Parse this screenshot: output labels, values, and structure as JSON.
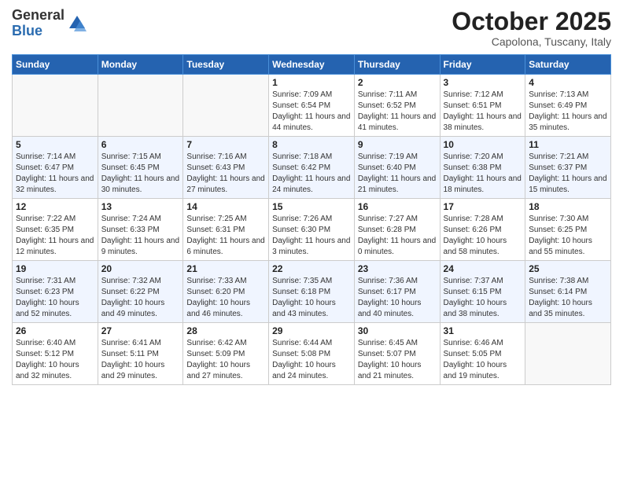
{
  "logo": {
    "general": "General",
    "blue": "Blue"
  },
  "header": {
    "month": "October 2025",
    "location": "Capolona, Tuscany, Italy"
  },
  "days_of_week": [
    "Sunday",
    "Monday",
    "Tuesday",
    "Wednesday",
    "Thursday",
    "Friday",
    "Saturday"
  ],
  "weeks": [
    [
      {
        "day": "",
        "info": ""
      },
      {
        "day": "",
        "info": ""
      },
      {
        "day": "",
        "info": ""
      },
      {
        "day": "1",
        "info": "Sunrise: 7:09 AM\nSunset: 6:54 PM\nDaylight: 11 hours and 44 minutes."
      },
      {
        "day": "2",
        "info": "Sunrise: 7:11 AM\nSunset: 6:52 PM\nDaylight: 11 hours and 41 minutes."
      },
      {
        "day": "3",
        "info": "Sunrise: 7:12 AM\nSunset: 6:51 PM\nDaylight: 11 hours and 38 minutes."
      },
      {
        "day": "4",
        "info": "Sunrise: 7:13 AM\nSunset: 6:49 PM\nDaylight: 11 hours and 35 minutes."
      }
    ],
    [
      {
        "day": "5",
        "info": "Sunrise: 7:14 AM\nSunset: 6:47 PM\nDaylight: 11 hours and 32 minutes."
      },
      {
        "day": "6",
        "info": "Sunrise: 7:15 AM\nSunset: 6:45 PM\nDaylight: 11 hours and 30 minutes."
      },
      {
        "day": "7",
        "info": "Sunrise: 7:16 AM\nSunset: 6:43 PM\nDaylight: 11 hours and 27 minutes."
      },
      {
        "day": "8",
        "info": "Sunrise: 7:18 AM\nSunset: 6:42 PM\nDaylight: 11 hours and 24 minutes."
      },
      {
        "day": "9",
        "info": "Sunrise: 7:19 AM\nSunset: 6:40 PM\nDaylight: 11 hours and 21 minutes."
      },
      {
        "day": "10",
        "info": "Sunrise: 7:20 AM\nSunset: 6:38 PM\nDaylight: 11 hours and 18 minutes."
      },
      {
        "day": "11",
        "info": "Sunrise: 7:21 AM\nSunset: 6:37 PM\nDaylight: 11 hours and 15 minutes."
      }
    ],
    [
      {
        "day": "12",
        "info": "Sunrise: 7:22 AM\nSunset: 6:35 PM\nDaylight: 11 hours and 12 minutes."
      },
      {
        "day": "13",
        "info": "Sunrise: 7:24 AM\nSunset: 6:33 PM\nDaylight: 11 hours and 9 minutes."
      },
      {
        "day": "14",
        "info": "Sunrise: 7:25 AM\nSunset: 6:31 PM\nDaylight: 11 hours and 6 minutes."
      },
      {
        "day": "15",
        "info": "Sunrise: 7:26 AM\nSunset: 6:30 PM\nDaylight: 11 hours and 3 minutes."
      },
      {
        "day": "16",
        "info": "Sunrise: 7:27 AM\nSunset: 6:28 PM\nDaylight: 11 hours and 0 minutes."
      },
      {
        "day": "17",
        "info": "Sunrise: 7:28 AM\nSunset: 6:26 PM\nDaylight: 10 hours and 58 minutes."
      },
      {
        "day": "18",
        "info": "Sunrise: 7:30 AM\nSunset: 6:25 PM\nDaylight: 10 hours and 55 minutes."
      }
    ],
    [
      {
        "day": "19",
        "info": "Sunrise: 7:31 AM\nSunset: 6:23 PM\nDaylight: 10 hours and 52 minutes."
      },
      {
        "day": "20",
        "info": "Sunrise: 7:32 AM\nSunset: 6:22 PM\nDaylight: 10 hours and 49 minutes."
      },
      {
        "day": "21",
        "info": "Sunrise: 7:33 AM\nSunset: 6:20 PM\nDaylight: 10 hours and 46 minutes."
      },
      {
        "day": "22",
        "info": "Sunrise: 7:35 AM\nSunset: 6:18 PM\nDaylight: 10 hours and 43 minutes."
      },
      {
        "day": "23",
        "info": "Sunrise: 7:36 AM\nSunset: 6:17 PM\nDaylight: 10 hours and 40 minutes."
      },
      {
        "day": "24",
        "info": "Sunrise: 7:37 AM\nSunset: 6:15 PM\nDaylight: 10 hours and 38 minutes."
      },
      {
        "day": "25",
        "info": "Sunrise: 7:38 AM\nSunset: 6:14 PM\nDaylight: 10 hours and 35 minutes."
      }
    ],
    [
      {
        "day": "26",
        "info": "Sunrise: 6:40 AM\nSunset: 5:12 PM\nDaylight: 10 hours and 32 minutes."
      },
      {
        "day": "27",
        "info": "Sunrise: 6:41 AM\nSunset: 5:11 PM\nDaylight: 10 hours and 29 minutes."
      },
      {
        "day": "28",
        "info": "Sunrise: 6:42 AM\nSunset: 5:09 PM\nDaylight: 10 hours and 27 minutes."
      },
      {
        "day": "29",
        "info": "Sunrise: 6:44 AM\nSunset: 5:08 PM\nDaylight: 10 hours and 24 minutes."
      },
      {
        "day": "30",
        "info": "Sunrise: 6:45 AM\nSunset: 5:07 PM\nDaylight: 10 hours and 21 minutes."
      },
      {
        "day": "31",
        "info": "Sunrise: 6:46 AM\nSunset: 5:05 PM\nDaylight: 10 hours and 19 minutes."
      },
      {
        "day": "",
        "info": ""
      }
    ]
  ]
}
